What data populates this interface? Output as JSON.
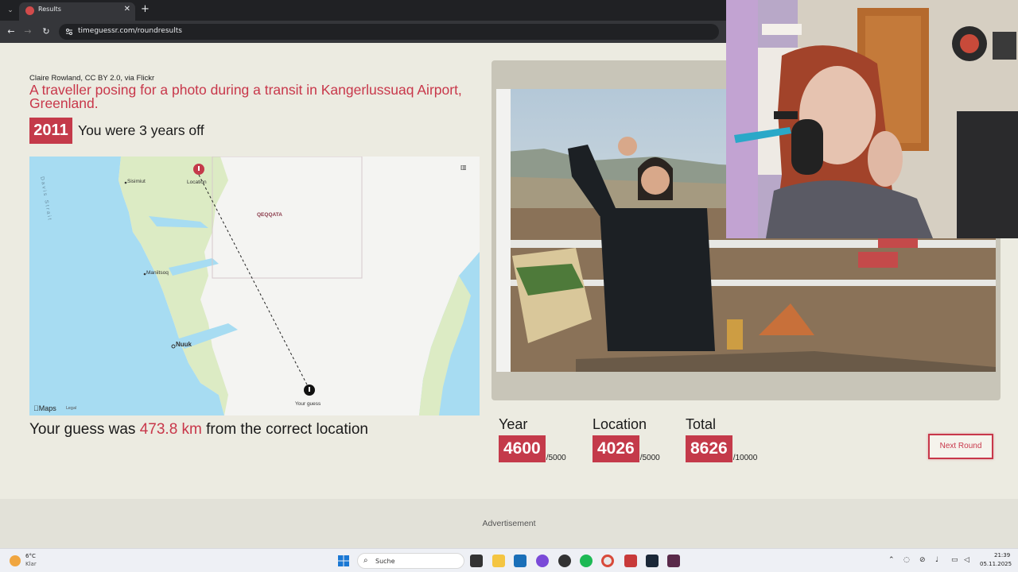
{
  "browser": {
    "tab_title": "Results",
    "tab_close": "✕",
    "new_tab": "+",
    "url": "timeguessr.com/roundresults"
  },
  "result": {
    "credit": "Claire Rowland, CC BY 2.0, via Flickr",
    "description": "A traveller posing for a photo during a transit in Kangerlussuaq Airport, Greenland.",
    "year": "2011",
    "years_off": "You were 3 years off",
    "distance_prefix": "Your guess was ",
    "distance_value": "473.8 km",
    "distance_suffix": " from the correct location"
  },
  "map": {
    "labels": {
      "sisimiut": "Sisimiut",
      "location": "Location",
      "qeqqata": "QEQQATA",
      "maniitsoq": "Maniitsoq",
      "nuuk": "Nuuk",
      "your_guess": "Your guess",
      "davis_strait": "Davis Strait"
    },
    "logo": "Maps",
    "legal": "Legal"
  },
  "scores": {
    "year": {
      "label": "Year",
      "value": "4600",
      "max": "/5000"
    },
    "location": {
      "label": "Location",
      "value": "4026",
      "max": "/5000"
    },
    "total": {
      "label": "Total",
      "value": "8626",
      "max": "/10000"
    }
  },
  "next_round": "Next Round",
  "advertisement": "Advertisement",
  "taskbar": {
    "weather_temp": "6°C",
    "weather_cond": "Klar",
    "search_placeholder": "Suche",
    "time": "21:39",
    "date": "05.11.2025"
  },
  "colors": {
    "accent": "#c43a4a",
    "background": "#ecebe1",
    "sea": "#a7dcf2"
  }
}
